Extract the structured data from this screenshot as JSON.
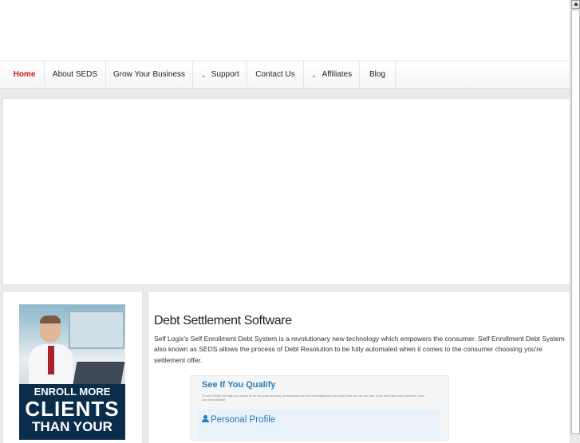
{
  "nav": {
    "items": [
      {
        "label": "Home",
        "active": true,
        "dropdown": false
      },
      {
        "label": "About SEDS",
        "active": false,
        "dropdown": false
      },
      {
        "label": "Grow Your Business",
        "active": false,
        "dropdown": false
      },
      {
        "label": "Support",
        "active": false,
        "dropdown": true
      },
      {
        "label": "Contact Us",
        "active": false,
        "dropdown": false
      },
      {
        "label": "Affiliates",
        "active": false,
        "dropdown": true
      },
      {
        "label": "Blog",
        "active": false,
        "dropdown": false
      }
    ]
  },
  "sidebar": {
    "ad": {
      "line1": "ENROLL MORE",
      "line2": "CLIENTS",
      "line3": "THAN YOUR"
    }
  },
  "content": {
    "title": "Debt Settlement Software",
    "paragraph": "Self Logix's Self Enrollment Debt System is a revolutionary new technology which empowers the consumer. Self Enrollment Debt System also known as SEDS allows the process of Debt Resolution to be fully automated when it comes to the consumer choosing you're settlement offer.",
    "qualify": {
      "title": "See If You Qualify",
      "subtitle": "To see if eDebt can help you, please fill out this quick and easy questionnaire and we'll immediately let you know if and how we can help. If you don't have exact numbers, enter your best estimate.",
      "section": "Personal Profile"
    }
  },
  "colors": {
    "accent_red": "#d01a1a",
    "link_blue": "#2b7dba",
    "ad_navy": "#0b2d4c"
  }
}
